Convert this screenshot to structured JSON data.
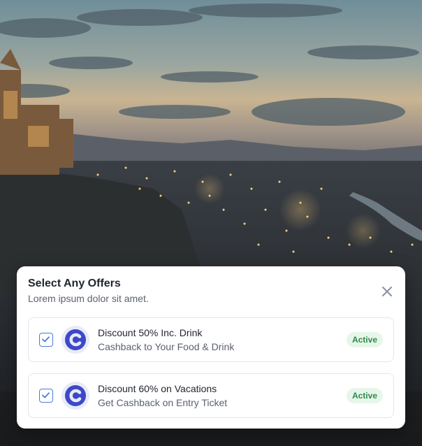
{
  "modal": {
    "title": "Select Any Offers",
    "subtitle": "Lorem ipsum dolor sit amet.",
    "close_icon": "close-icon"
  },
  "offers": [
    {
      "title": "Discount 50% Inc. Drink",
      "subtitle": "Cashback to Your Food & Drink",
      "status": "Active",
      "checked": true,
      "logo_icon": "brand-c-logo"
    },
    {
      "title": "Discount 60% on Vacations",
      "subtitle": "Get Cashback on Entry Ticket",
      "status": "Active",
      "checked": true,
      "logo_icon": "brand-c-logo"
    }
  ],
  "colors": {
    "checkbox_accent": "#4a7bd8",
    "badge_bg": "#e6f6ea",
    "badge_text": "#2e8b48",
    "logo_accent": "#3d48c9"
  }
}
